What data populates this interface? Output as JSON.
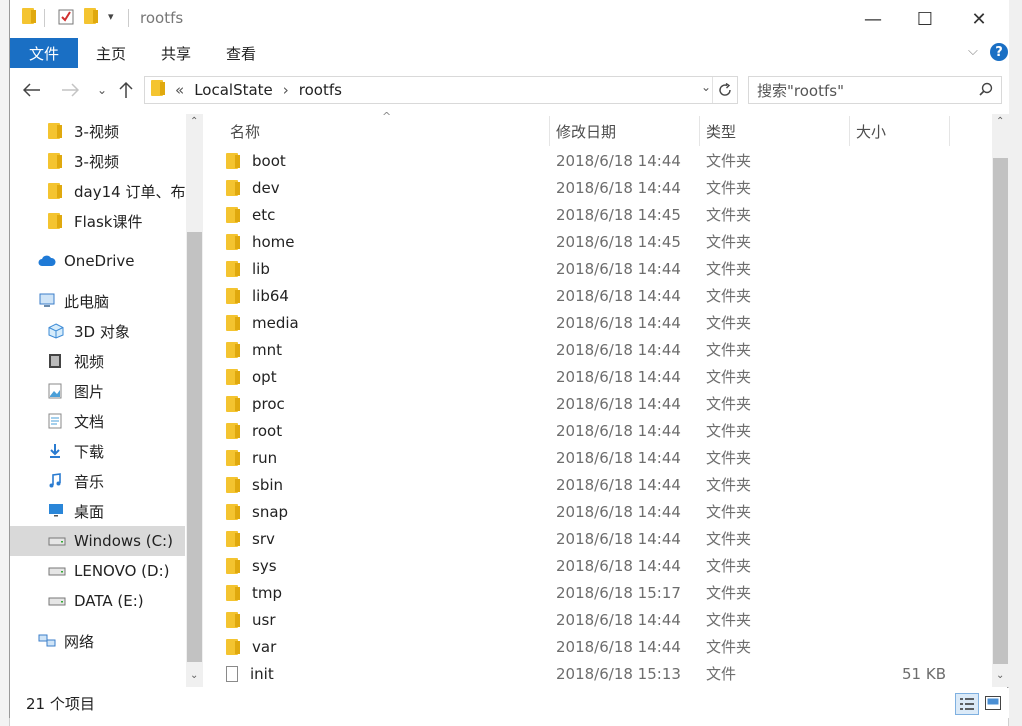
{
  "window": {
    "title": "rootfs",
    "controls": {
      "minimize": "—",
      "maximize": "☐",
      "close": "✕"
    }
  },
  "ribbon": {
    "file_tab": "文件",
    "tabs": [
      "主页",
      "共享",
      "查看"
    ],
    "help": "?"
  },
  "address": {
    "overflow": "«",
    "crumbs": [
      "LocalState",
      "rootfs"
    ],
    "sep": "›"
  },
  "search": {
    "placeholder": "搜索\"rootfs\""
  },
  "nav": {
    "items": [
      {
        "label": "3-视频",
        "icon": "folder-icon"
      },
      {
        "label": "3-视频",
        "icon": "folder-icon"
      },
      {
        "label": "day14 订单、布",
        "icon": "folder-icon"
      },
      {
        "label": "Flask课件",
        "icon": "folder-icon"
      },
      {
        "label": "OneDrive",
        "icon": "cloud-icon"
      },
      {
        "label": "此电脑",
        "icon": "computer-icon"
      },
      {
        "label": "3D 对象",
        "icon": "cube-icon"
      },
      {
        "label": "视频",
        "icon": "video-icon"
      },
      {
        "label": "图片",
        "icon": "pictures-icon"
      },
      {
        "label": "文档",
        "icon": "documents-icon"
      },
      {
        "label": "下载",
        "icon": "download-icon"
      },
      {
        "label": "音乐",
        "icon": "music-icon"
      },
      {
        "label": "桌面",
        "icon": "desktop-icon"
      },
      {
        "label": "Windows (C:)",
        "icon": "drive-icon"
      },
      {
        "label": "LENOVO (D:)",
        "icon": "drive-icon"
      },
      {
        "label": "DATA (E:)",
        "icon": "drive-icon"
      },
      {
        "label": "网络",
        "icon": "network-icon"
      }
    ]
  },
  "columns": {
    "name": "名称",
    "date": "修改日期",
    "type": "类型",
    "size": "大小"
  },
  "files": [
    {
      "name": "boot",
      "date": "2018/6/18 14:44",
      "type": "文件夹",
      "size": ""
    },
    {
      "name": "dev",
      "date": "2018/6/18 14:44",
      "type": "文件夹",
      "size": ""
    },
    {
      "name": "etc",
      "date": "2018/6/18 14:45",
      "type": "文件夹",
      "size": ""
    },
    {
      "name": "home",
      "date": "2018/6/18 14:45",
      "type": "文件夹",
      "size": ""
    },
    {
      "name": "lib",
      "date": "2018/6/18 14:44",
      "type": "文件夹",
      "size": ""
    },
    {
      "name": "lib64",
      "date": "2018/6/18 14:44",
      "type": "文件夹",
      "size": ""
    },
    {
      "name": "media",
      "date": "2018/6/18 14:44",
      "type": "文件夹",
      "size": ""
    },
    {
      "name": "mnt",
      "date": "2018/6/18 14:44",
      "type": "文件夹",
      "size": ""
    },
    {
      "name": "opt",
      "date": "2018/6/18 14:44",
      "type": "文件夹",
      "size": ""
    },
    {
      "name": "proc",
      "date": "2018/6/18 14:44",
      "type": "文件夹",
      "size": ""
    },
    {
      "name": "root",
      "date": "2018/6/18 14:44",
      "type": "文件夹",
      "size": ""
    },
    {
      "name": "run",
      "date": "2018/6/18 14:44",
      "type": "文件夹",
      "size": ""
    },
    {
      "name": "sbin",
      "date": "2018/6/18 14:44",
      "type": "文件夹",
      "size": ""
    },
    {
      "name": "snap",
      "date": "2018/6/18 14:44",
      "type": "文件夹",
      "size": ""
    },
    {
      "name": "srv",
      "date": "2018/6/18 14:44",
      "type": "文件夹",
      "size": ""
    },
    {
      "name": "sys",
      "date": "2018/6/18 14:44",
      "type": "文件夹",
      "size": ""
    },
    {
      "name": "tmp",
      "date": "2018/6/18 15:17",
      "type": "文件夹",
      "size": ""
    },
    {
      "name": "usr",
      "date": "2018/6/18 14:44",
      "type": "文件夹",
      "size": ""
    },
    {
      "name": "var",
      "date": "2018/6/18 14:44",
      "type": "文件夹",
      "size": ""
    },
    {
      "name": "init",
      "date": "2018/6/18 15:13",
      "type": "文件",
      "size": "51 KB"
    }
  ],
  "status": {
    "count": "21 个项目"
  },
  "colors": {
    "accent": "#1a6fc4",
    "folder": "#f4c430",
    "selected": "#d9d9d9"
  }
}
